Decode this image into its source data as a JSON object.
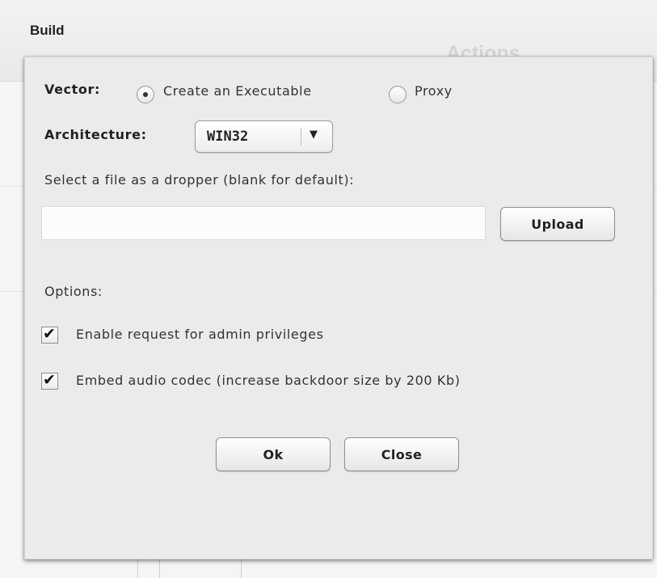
{
  "background": {
    "title": "Build",
    "column_header": "Actions"
  },
  "dialog": {
    "vector": {
      "label": "Vector:",
      "options": [
        {
          "label": "Create an Executable",
          "selected": true
        },
        {
          "label": "Proxy",
          "selected": false
        }
      ]
    },
    "architecture": {
      "label": "Architecture:",
      "selected": "WIN32",
      "dropdown_icon": "triangle-down-icon"
    },
    "dropper": {
      "label": "Select a file as a dropper (blank for default):",
      "value": "",
      "upload_label": "Upload"
    },
    "options": {
      "label": "Options:",
      "items": [
        {
          "label": "Enable request for admin privileges",
          "checked": true
        },
        {
          "label": "Embed audio codec (increase backdoor size by 200 Kb)",
          "checked": true
        }
      ]
    },
    "buttons": {
      "ok": "Ok",
      "close": "Close"
    }
  },
  "colors": {
    "dialog_bg": "#ebebeb",
    "page_bg": "#f7f7f7",
    "text": "#333333"
  }
}
